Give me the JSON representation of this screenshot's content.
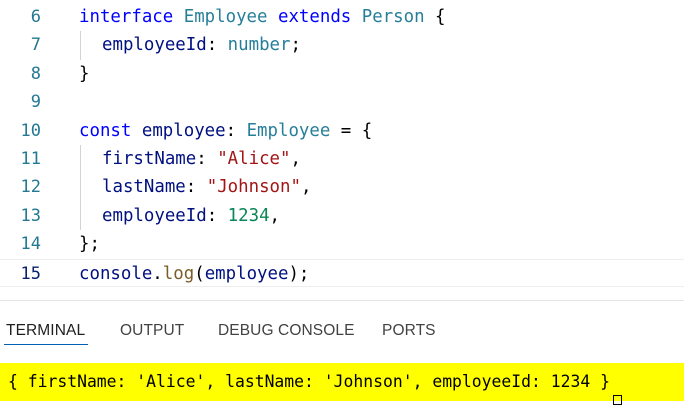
{
  "editor": {
    "lines": [
      {
        "number": "6",
        "tokens": [
          {
            "text": "interface",
            "cls": "kw"
          },
          {
            "text": " ",
            "cls": "plain"
          },
          {
            "text": "Employee",
            "cls": "type"
          },
          {
            "text": " ",
            "cls": "plain"
          },
          {
            "text": "extends",
            "cls": "kw"
          },
          {
            "text": " ",
            "cls": "plain"
          },
          {
            "text": "Person",
            "cls": "type"
          },
          {
            "text": " {",
            "cls": "plain"
          }
        ]
      },
      {
        "number": "7",
        "indent": true,
        "tokens": [
          {
            "text": "employeeId",
            "cls": "var"
          },
          {
            "text": ": ",
            "cls": "plain"
          },
          {
            "text": "number",
            "cls": "type"
          },
          {
            "text": ";",
            "cls": "plain"
          }
        ]
      },
      {
        "number": "8",
        "tokens": [
          {
            "text": "}",
            "cls": "plain"
          }
        ]
      },
      {
        "number": "9",
        "tokens": []
      },
      {
        "number": "10",
        "tokens": [
          {
            "text": "const",
            "cls": "kw"
          },
          {
            "text": " ",
            "cls": "plain"
          },
          {
            "text": "employee",
            "cls": "var"
          },
          {
            "text": ": ",
            "cls": "plain"
          },
          {
            "text": "Employee",
            "cls": "type"
          },
          {
            "text": " = {",
            "cls": "plain"
          }
        ]
      },
      {
        "number": "11",
        "indent": true,
        "tokens": [
          {
            "text": "firstName",
            "cls": "var"
          },
          {
            "text": ": ",
            "cls": "plain"
          },
          {
            "text": "\"Alice\"",
            "cls": "str"
          },
          {
            "text": ",",
            "cls": "plain"
          }
        ]
      },
      {
        "number": "12",
        "indent": true,
        "tokens": [
          {
            "text": "lastName",
            "cls": "var"
          },
          {
            "text": ": ",
            "cls": "plain"
          },
          {
            "text": "\"Johnson\"",
            "cls": "str"
          },
          {
            "text": ",",
            "cls": "plain"
          }
        ]
      },
      {
        "number": "13",
        "indent": true,
        "tokens": [
          {
            "text": "employeeId",
            "cls": "var"
          },
          {
            "text": ": ",
            "cls": "plain"
          },
          {
            "text": "1234",
            "cls": "num"
          },
          {
            "text": ",",
            "cls": "plain"
          }
        ]
      },
      {
        "number": "14",
        "tokens": [
          {
            "text": "};",
            "cls": "plain"
          }
        ]
      },
      {
        "number": "15",
        "active": true,
        "tokens": [
          {
            "text": "console",
            "cls": "var"
          },
          {
            "text": ".",
            "cls": "plain"
          },
          {
            "text": "log",
            "cls": "fn"
          },
          {
            "text": "(",
            "cls": "plain"
          },
          {
            "text": "employee",
            "cls": "var"
          },
          {
            "text": ");",
            "cls": "plain"
          }
        ]
      }
    ]
  },
  "panel": {
    "tabs": [
      {
        "label": "TERMINAL",
        "active": true
      },
      {
        "label": "OUTPUT"
      },
      {
        "label": "DEBUG CONSOLE"
      },
      {
        "label": "PORTS"
      }
    ]
  },
  "terminal": {
    "output": "{ firstName: 'Alice', lastName: 'Johnson', employeeId: 1234 }",
    "highlight_color": "#ffff00"
  },
  "colors": {
    "keyword": "#0000ff",
    "type": "#267f99",
    "variable": "#001080",
    "string": "#a31515",
    "number": "#098658",
    "function": "#795e26",
    "line_number": "#237893",
    "active_tab_underline": "#005fb8"
  }
}
